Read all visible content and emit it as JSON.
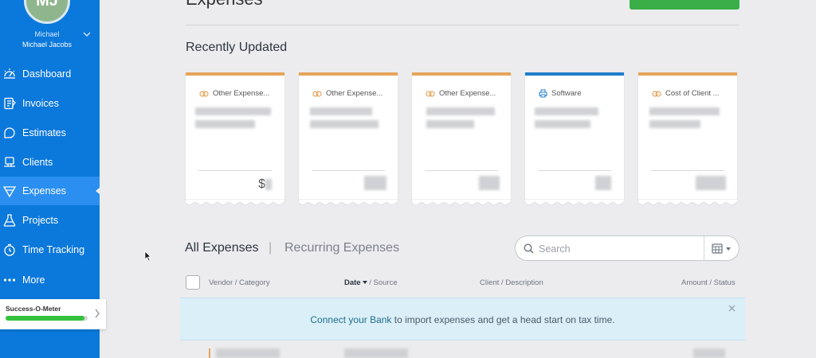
{
  "sidebar": {
    "avatar_initials": "MJ",
    "user_first": "Michael",
    "user_full": "Michael Jacobs",
    "nav": [
      {
        "label": "Dashboard",
        "icon": "dashboard-icon"
      },
      {
        "label": "Invoices",
        "icon": "invoices-icon"
      },
      {
        "label": "Estimates",
        "icon": "estimates-icon"
      },
      {
        "label": "Clients",
        "icon": "clients-icon"
      },
      {
        "label": "Expenses",
        "icon": "expenses-icon",
        "active": true
      },
      {
        "label": "Projects",
        "icon": "projects-icon"
      },
      {
        "label": "Time Tracking",
        "icon": "clock-icon"
      },
      {
        "label": "More",
        "icon": "more-dots-icon"
      }
    ],
    "meter": {
      "label": "Success-O-Meter",
      "progress": 0.96
    }
  },
  "header": {
    "title": "Expenses"
  },
  "recent": {
    "title": "Recently Updated",
    "cards": [
      {
        "category": "Other Expense...",
        "amount": "$",
        "accent": "#e6a45a",
        "icon": "wallet-icon"
      },
      {
        "category": "Other Expense...",
        "amount": "",
        "accent": "#e6a45a",
        "icon": "wallet-icon"
      },
      {
        "category": "Other Expense...",
        "amount": "",
        "accent": "#e6a45a",
        "icon": "wallet-icon"
      },
      {
        "category": "Software",
        "amount": "",
        "accent": "#1f7dcc",
        "icon": "printer-icon"
      },
      {
        "category": "Cost of Client ...",
        "amount": "",
        "accent": "#e6a45a",
        "icon": "wallet-icon"
      }
    ]
  },
  "tabs": {
    "all": "All Expenses",
    "separator": "|",
    "recurring": "Recurring Expenses"
  },
  "search": {
    "placeholder": "Search"
  },
  "table": {
    "columns": {
      "vendor": "Vendor / Category",
      "date": "Date",
      "source": " / Source",
      "client": "Client / Description",
      "amount": "Amount / Status"
    }
  },
  "banner": {
    "link": "Connect your Bank",
    "text": " to import expenses and get a head start on tax time."
  },
  "colors": {
    "sidebar": "#0b78dc",
    "active": "#2a8ff0",
    "orange_accent": "#e6a45a",
    "blue_accent": "#1f7dcc",
    "banner": "#dbeff9"
  }
}
